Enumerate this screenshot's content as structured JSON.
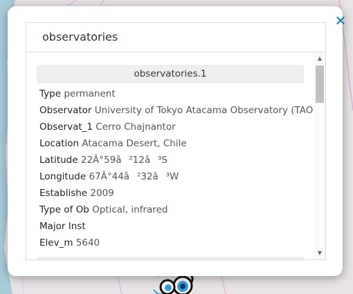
{
  "popup": {
    "close_icon": "close-icon",
    "header": "observatories",
    "feature_title": "observatories.1",
    "attributes": [
      {
        "key": "Type",
        "value": "permanent"
      },
      {
        "key": "Observator",
        "value": "University of Tokyo Atacama Observatory (TAO)"
      },
      {
        "key": "Observat_1",
        "value": "Cerro Chajnantor"
      },
      {
        "key": "Location",
        "value": "Atacama Desert, Chile"
      },
      {
        "key": "Latitude",
        "value": "22Â°59â²12â³S"
      },
      {
        "key": "Longitude",
        "value": "67Â°44â²32â³W"
      },
      {
        "key": "Establishe",
        "value": "2009"
      },
      {
        "key": "Type of Ob",
        "value": "Optical, infrared"
      },
      {
        "key": "Major Inst",
        "value": ""
      },
      {
        "key": "Elev_m",
        "value": "5640"
      }
    ]
  },
  "scrollbar": {
    "up_icon": "scroll-up-arrow-icon",
    "down_icon": "scroll-down-arrow-icon",
    "position": 0
  },
  "map": {
    "marker_icon": "observatory-marker-icon",
    "colors": {
      "land": "#e8e3e6",
      "water": "#a7cbd9",
      "border": "#c9a7c9",
      "accent": "#0079c1"
    }
  }
}
